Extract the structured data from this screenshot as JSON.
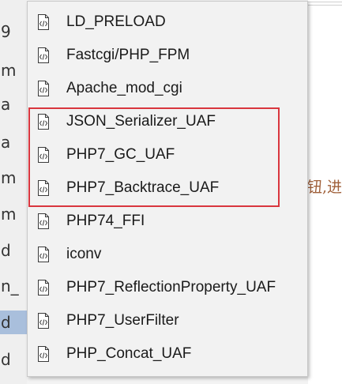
{
  "background": {
    "left_fragments": [
      "9",
      "m",
      "a",
      "a",
      "m",
      "m",
      "d",
      "n_",
      "d",
      "d"
    ],
    "selected_fragment_index": 8,
    "right_text": "钮,进"
  },
  "menu": {
    "items": [
      {
        "label": "LD_PRELOAD",
        "icon": "script-file-icon"
      },
      {
        "label": "Fastcgi/PHP_FPM",
        "icon": "script-file-icon"
      },
      {
        "label": "Apache_mod_cgi",
        "icon": "script-file-icon"
      },
      {
        "label": "JSON_Serializer_UAF",
        "icon": "script-file-icon"
      },
      {
        "label": "PHP7_GC_UAF",
        "icon": "script-file-icon"
      },
      {
        "label": "PHP7_Backtrace_UAF",
        "icon": "script-file-icon"
      },
      {
        "label": "PHP74_FFI",
        "icon": "script-file-icon"
      },
      {
        "label": "iconv",
        "icon": "script-file-icon"
      },
      {
        "label": "PHP7_ReflectionProperty_UAF",
        "icon": "script-file-icon"
      },
      {
        "label": "PHP7_UserFilter",
        "icon": "script-file-icon"
      },
      {
        "label": "PHP_Concat_UAF",
        "icon": "script-file-icon"
      }
    ],
    "highlighted_item_indices": [
      3,
      4,
      5
    ],
    "highlight_color": "#d9363e"
  }
}
